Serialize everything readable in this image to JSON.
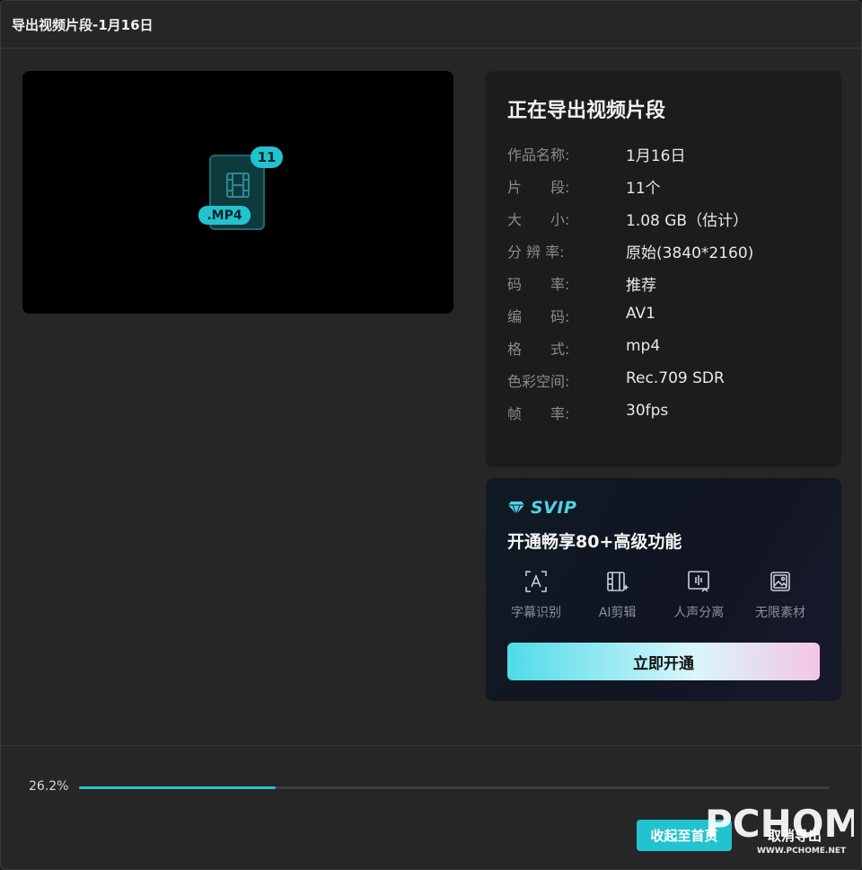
{
  "window": {
    "title": "导出视频片段-1月16日"
  },
  "preview": {
    "badge_count": "11",
    "file_ext": ".MP4"
  },
  "info": {
    "heading": "正在导出视频片段",
    "rows": [
      {
        "key": "作品名称:",
        "value": "1月16日"
      },
      {
        "key": "片　　段:",
        "value": "11个"
      },
      {
        "key": "大　　小:",
        "value": "1.08 GB（估计）"
      },
      {
        "key": "分 辨 率:",
        "value": "原始(3840*2160)"
      },
      {
        "key": "码　　率:",
        "value": "推荐"
      },
      {
        "key": "编　　码:",
        "value": "AV1"
      },
      {
        "key": "格　　式:",
        "value": "mp4"
      },
      {
        "key": "色彩空间:",
        "value": "Rec.709 SDR"
      },
      {
        "key": "帧　　率:",
        "value": "30fps"
      }
    ]
  },
  "svip": {
    "logo_text": "SVIP",
    "headline": "开通畅享80+高级功能",
    "features": [
      {
        "label": "字幕识别",
        "icon": "subtitle-recognition-icon"
      },
      {
        "label": "AI剪辑",
        "icon": "ai-edit-icon"
      },
      {
        "label": "人声分离",
        "icon": "voice-separation-icon"
      },
      {
        "label": "无限素材",
        "icon": "unlimited-assets-icon"
      }
    ],
    "button_label": "立即开通"
  },
  "progress": {
    "label": "26.2%",
    "value": 0.262
  },
  "footer": {
    "home_button": "收起至首页",
    "cancel_button": "取消导出"
  },
  "watermark": {
    "text": "PCHOME",
    "url": "WWW.PCHOME.NET"
  },
  "colors": {
    "accent": "#22c3d0",
    "background": "#262626",
    "panel": "#1c1c1c"
  }
}
